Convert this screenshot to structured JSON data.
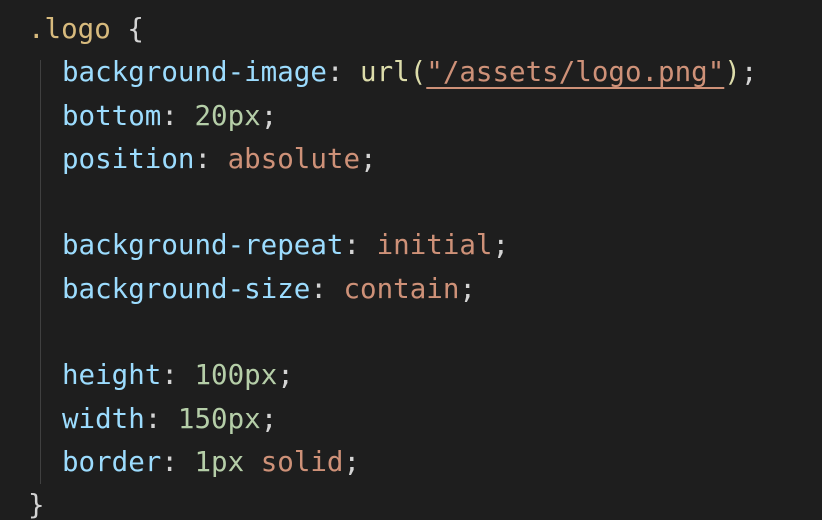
{
  "editor": {
    "language": "css",
    "selector": ".logo",
    "open_brace": "{",
    "close_brace": "}",
    "lines": {
      "bg_image": {
        "property": "background-image",
        "colon": ":",
        "func": "url(",
        "value": "\"/assets/logo.png\"",
        "func_close": ")",
        "semicolon": ";"
      },
      "bottom": {
        "property": "bottom",
        "colon": ":",
        "value": "20px",
        "semicolon": ";"
      },
      "position": {
        "property": "position",
        "colon": ":",
        "value": "absolute",
        "semicolon": ";"
      },
      "bg_repeat": {
        "property": "background-repeat",
        "colon": ":",
        "value": "initial",
        "semicolon": ";"
      },
      "bg_size": {
        "property": "background-size",
        "colon": ":",
        "value": "contain",
        "semicolon": ";"
      },
      "height": {
        "property": "height",
        "colon": ":",
        "value": "100px",
        "semicolon": ";"
      },
      "width": {
        "property": "width",
        "colon": ":",
        "value": "150px",
        "semicolon": ";"
      },
      "border": {
        "property": "border",
        "colon": ":",
        "value_num": "1px",
        "value_kw": "solid",
        "semicolon": ";"
      }
    }
  },
  "colors": {
    "background": "#1e1e1e",
    "selector": "#d7ba7d",
    "property": "#9cdcfe",
    "string_value": "#ce9178",
    "number": "#b5cea8",
    "function": "#dcdcaa",
    "punctuation": "#d4d4d4"
  }
}
